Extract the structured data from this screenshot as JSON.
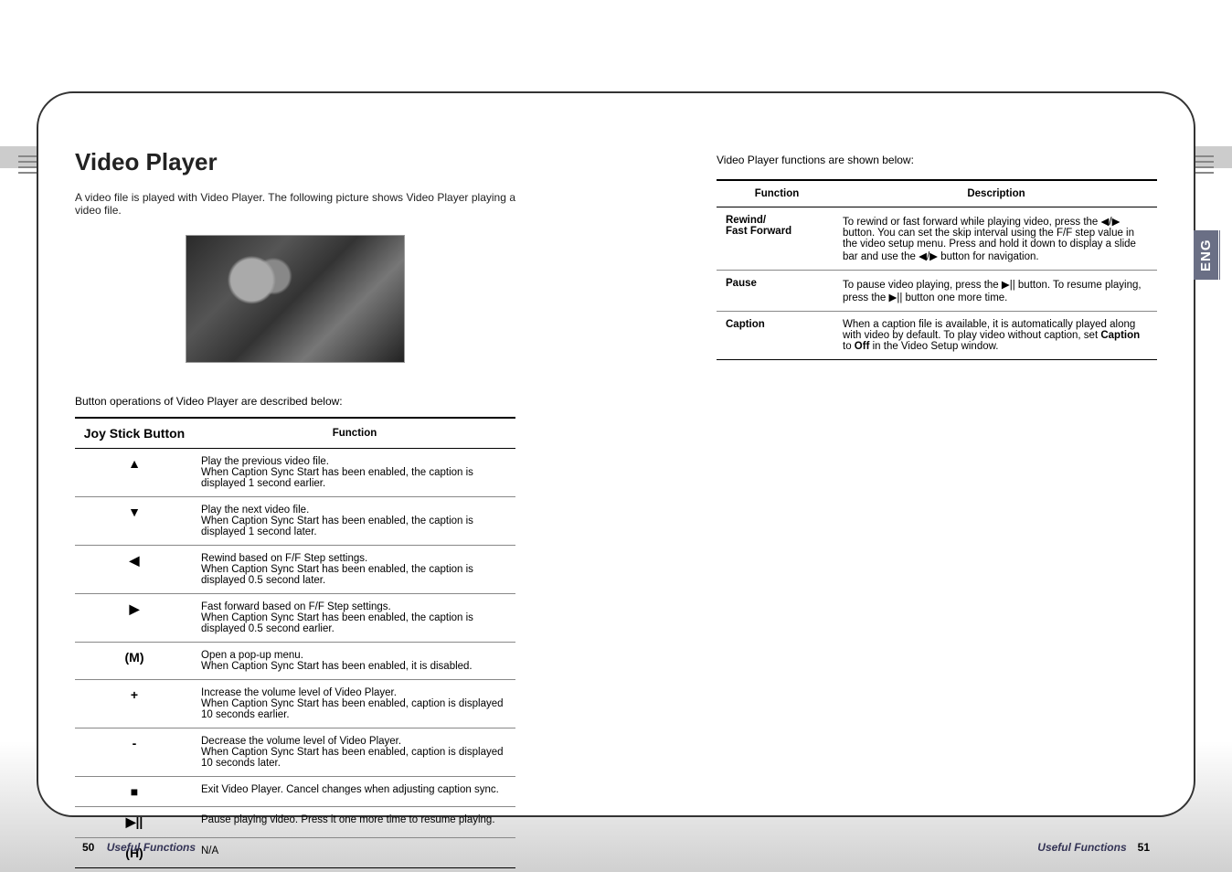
{
  "lang_tab": "ENG",
  "left": {
    "title": "Video Player",
    "intro": "A video file is played with Video Player. The following picture shows Video Player playing a video file.",
    "caption": "Button operations of Video Player are described below:",
    "table": {
      "headers": {
        "col1": "Joy Stick Button",
        "col2": "Function"
      },
      "rows": [
        {
          "btn": "▲",
          "fn": "Play the previous video file.\nWhen Caption Sync Start has been enabled, the caption is displayed 1 second earlier."
        },
        {
          "btn": "▼",
          "fn": "Play the next video file.\nWhen Caption Sync Start has been enabled, the caption is displayed 1 second later."
        },
        {
          "btn": "◀",
          "fn": "Rewind based on F/F Step settings.\nWhen Caption Sync Start has been enabled, the caption is displayed 0.5 second later."
        },
        {
          "btn": "▶",
          "fn": "Fast forward based on F/F Step settings.\nWhen Caption Sync Start has been enabled, the caption is displayed 0.5 second earlier."
        },
        {
          "btn": "(M)",
          "fn": "Open a pop-up menu.\nWhen Caption Sync Start has been enabled, it is disabled."
        },
        {
          "btn": "+",
          "fn": "Increase the volume level of Video Player.\nWhen Caption Sync Start has been enabled, caption is displayed 10 seconds earlier."
        },
        {
          "btn": "-",
          "fn": "Decrease the volume level of Video Player.\nWhen Caption Sync Start has been enabled, caption is displayed 10 seconds later."
        },
        {
          "btn": "■",
          "fn": "Exit Video Player. Cancel changes when adjusting caption sync."
        },
        {
          "btn": "▶||",
          "fn": "Pause playing video. Press it one more time to resume playing."
        },
        {
          "btn": "(H)",
          "fn": "N/A"
        }
      ]
    }
  },
  "right": {
    "caption": "Video Player functions are shown below:",
    "table": {
      "headers": {
        "col1": "Function",
        "col2": "Description"
      },
      "rows": [
        {
          "fn": "Rewind/\nFast Forward",
          "desc": "To rewind or fast forward while playing video, press the ◀/▶ button. You can set the skip interval using the F/F step value in the video setup menu. Press and hold it down to display a slide bar and use the ◀/▶ button for navigation."
        },
        {
          "fn": "Pause",
          "desc": "To pause video playing, press the ▶|| button. To resume playing, press the ▶|| button one more time."
        },
        {
          "fn": "Caption",
          "desc_pre": "When a caption file is available, it is automatically played along with video by default. To play video without caption, set ",
          "desc_bold1": "Caption",
          "desc_mid": " to ",
          "desc_bold2": "Off",
          "desc_post": " in the Video Setup window."
        }
      ]
    }
  },
  "footer": {
    "pg_left_num": "50",
    "pg_left_sec": "Useful Functions",
    "pg_right_sec": "Useful Functions",
    "pg_right_num": "51"
  }
}
